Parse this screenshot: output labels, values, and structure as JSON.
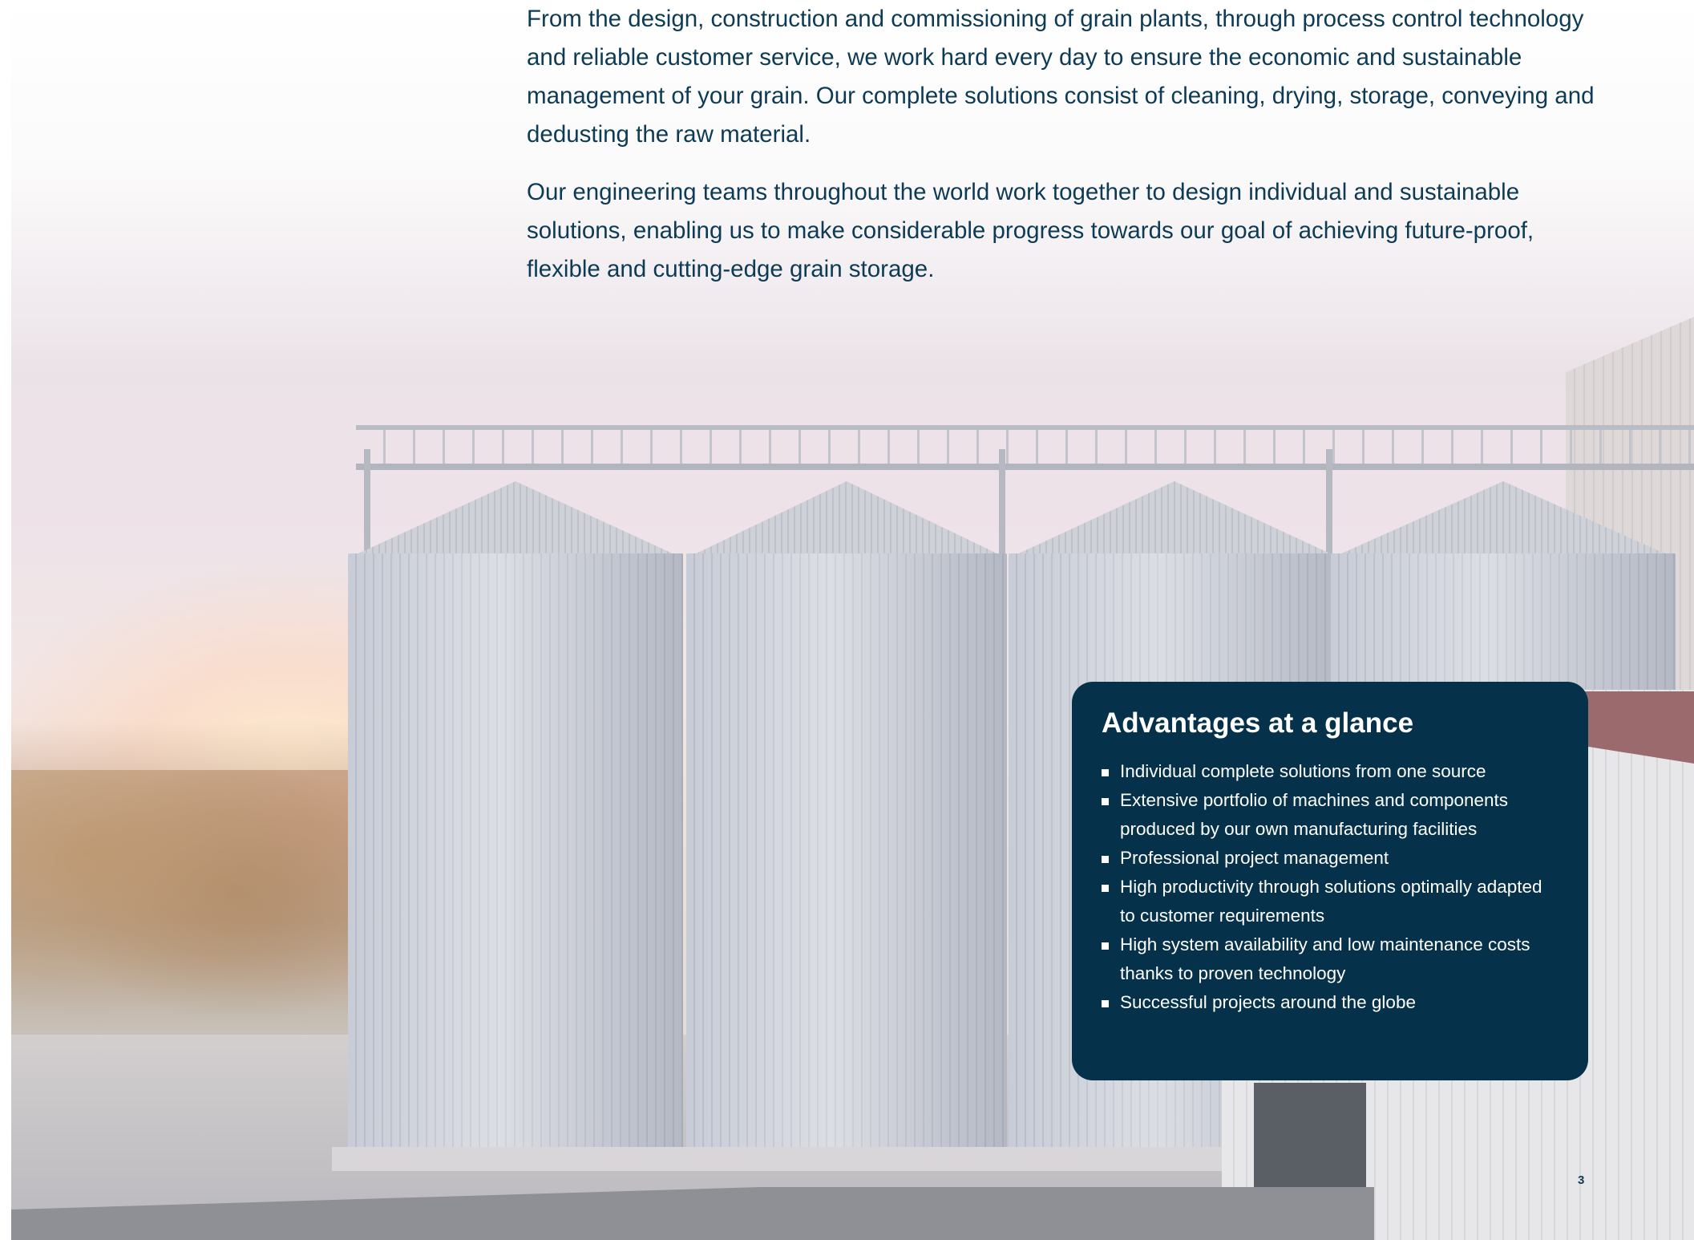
{
  "intro": {
    "paragraphs": [
      "From the design, construction and commissioning of grain plants, through process control technology and reliable customer service, we work hard every day to ensure the economic and sustainable management of your grain. Our complete solutions consist of cleaning, drying, storage, conveying and dedusting the raw material.",
      "Our engineering teams throughout the world work together to design individual and sustainable solutions, enabling us to make considerable progress towards our goal of achieving future-proof, flexible and cutting-edge grain storage."
    ]
  },
  "advantages": {
    "title": "Advantages at a glance",
    "items": [
      "Individual complete solutions from one source",
      "Extensive portfolio of machines and components produced by our own manufacturing facilities",
      "Professional project management",
      "High productivity through solutions optimally adapted to customer requirements",
      "High system availability and low maintenance costs thanks to proven technology",
      "Successful projects around the globe"
    ]
  },
  "page": {
    "number": "3"
  },
  "colors": {
    "text_navy": "#0d3b55",
    "card_background": "#05324a",
    "card_text": "#ffffff"
  }
}
